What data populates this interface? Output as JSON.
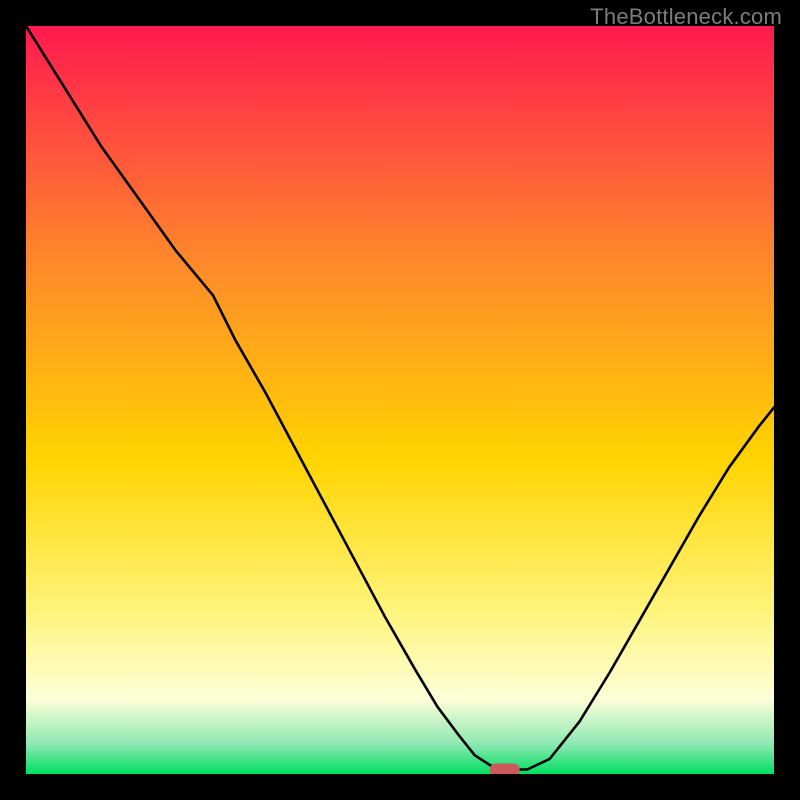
{
  "credit": "TheBottleneck.com",
  "gradient_colors": {
    "top": "#ff1a4f",
    "mid_upper": "#ff8a2a",
    "mid": "#ffd400",
    "mid_lower": "#fff47a",
    "pale": "#fdffd8",
    "near_bottom": "#8de8b3",
    "bottom": "#00e060"
  },
  "marker": {
    "fill": "#cc5a5a"
  },
  "chart_data": {
    "type": "line",
    "title": "",
    "xlabel": "",
    "ylabel": "",
    "xlim": [
      0,
      100
    ],
    "ylim": [
      0,
      100
    ],
    "x": [
      0,
      5,
      10,
      15,
      20,
      25,
      28,
      32,
      36,
      40,
      44,
      48,
      52,
      55,
      58,
      60,
      62,
      63.5,
      65,
      67,
      70,
      74,
      78,
      82,
      86,
      90,
      94,
      98,
      100
    ],
    "values": [
      100,
      92,
      84,
      77,
      70,
      64,
      58,
      51,
      43.5,
      36,
      28.5,
      21,
      14,
      9,
      5,
      2.5,
      1.2,
      0.6,
      0.6,
      0.6,
      2,
      7,
      13.5,
      20.5,
      27.5,
      34.5,
      41,
      46.5,
      49
    ],
    "marker_point": {
      "x": 64,
      "y": 0.6
    },
    "grid": false,
    "legend": false
  }
}
